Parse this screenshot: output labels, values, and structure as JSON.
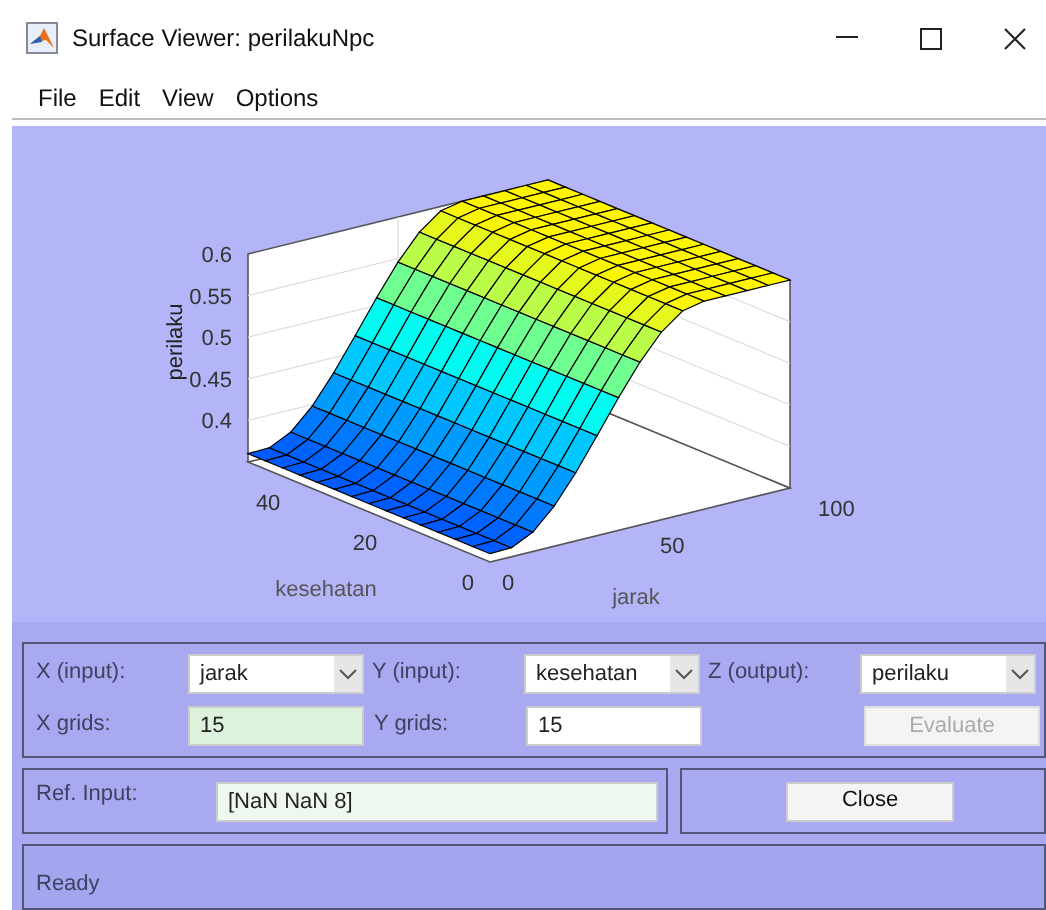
{
  "window": {
    "title": "Surface Viewer: perilakuNpc"
  },
  "menu": [
    "File",
    "Edit",
    "View",
    "Options"
  ],
  "plot": {
    "zlabel": "perilaku",
    "xlabel": "jarak",
    "ylabel": "kesehatan",
    "zticks": [
      "0.6",
      "0.55",
      "0.5",
      "0.45",
      "0.4"
    ],
    "xticks": [
      "0",
      "50",
      "100"
    ],
    "yticks": [
      "0",
      "20",
      "40"
    ]
  },
  "selectors": [
    {
      "label": "X (input):",
      "value": "jarak"
    },
    {
      "label": "Y (input):",
      "value": "kesehatan"
    },
    {
      "label": "Z (output):",
      "value": "perilaku"
    }
  ],
  "grids": [
    {
      "label": "X grids:",
      "value": "15",
      "tinted": true
    },
    {
      "label": "Y grids:",
      "value": "15",
      "tinted": false
    }
  ],
  "evaluate": {
    "label": "Evaluate",
    "disabled": true
  },
  "ref_input": {
    "label": "Ref. Input:",
    "value": "[NaN NaN 8]"
  },
  "close": {
    "label": "Close"
  },
  "status": "Ready"
}
